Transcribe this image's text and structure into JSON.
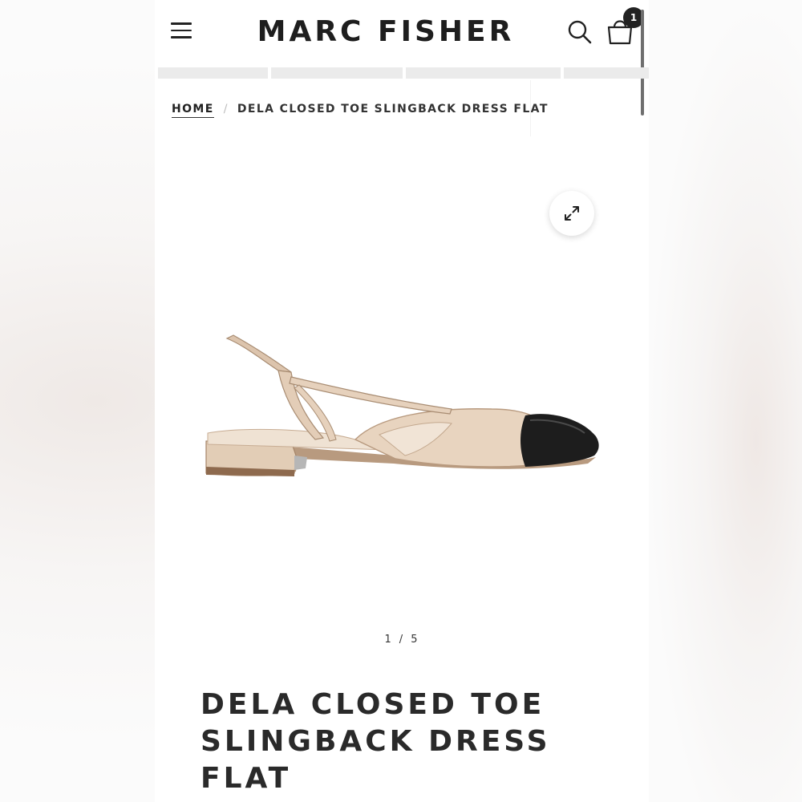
{
  "header": {
    "brand": "MARC FISHER",
    "cart_count": "1"
  },
  "breadcrumb": {
    "home": "HOME",
    "separator": "/",
    "current": "DELA CLOSED TOE SLINGBACK DRESS FLAT"
  },
  "gallery": {
    "current_index": "1",
    "separator": "/",
    "total": "5"
  },
  "product": {
    "title": "DELA CLOSED TOE SLINGBACK DRESS FLAT"
  },
  "icons": [
    "menu-icon",
    "search-icon",
    "cart-icon",
    "expand-icon"
  ],
  "colors": {
    "text": "#222222",
    "shoe_body": "#e6d2bd",
    "shoe_toe": "#1c1c1c",
    "nav_strip": "#ebebeb"
  }
}
